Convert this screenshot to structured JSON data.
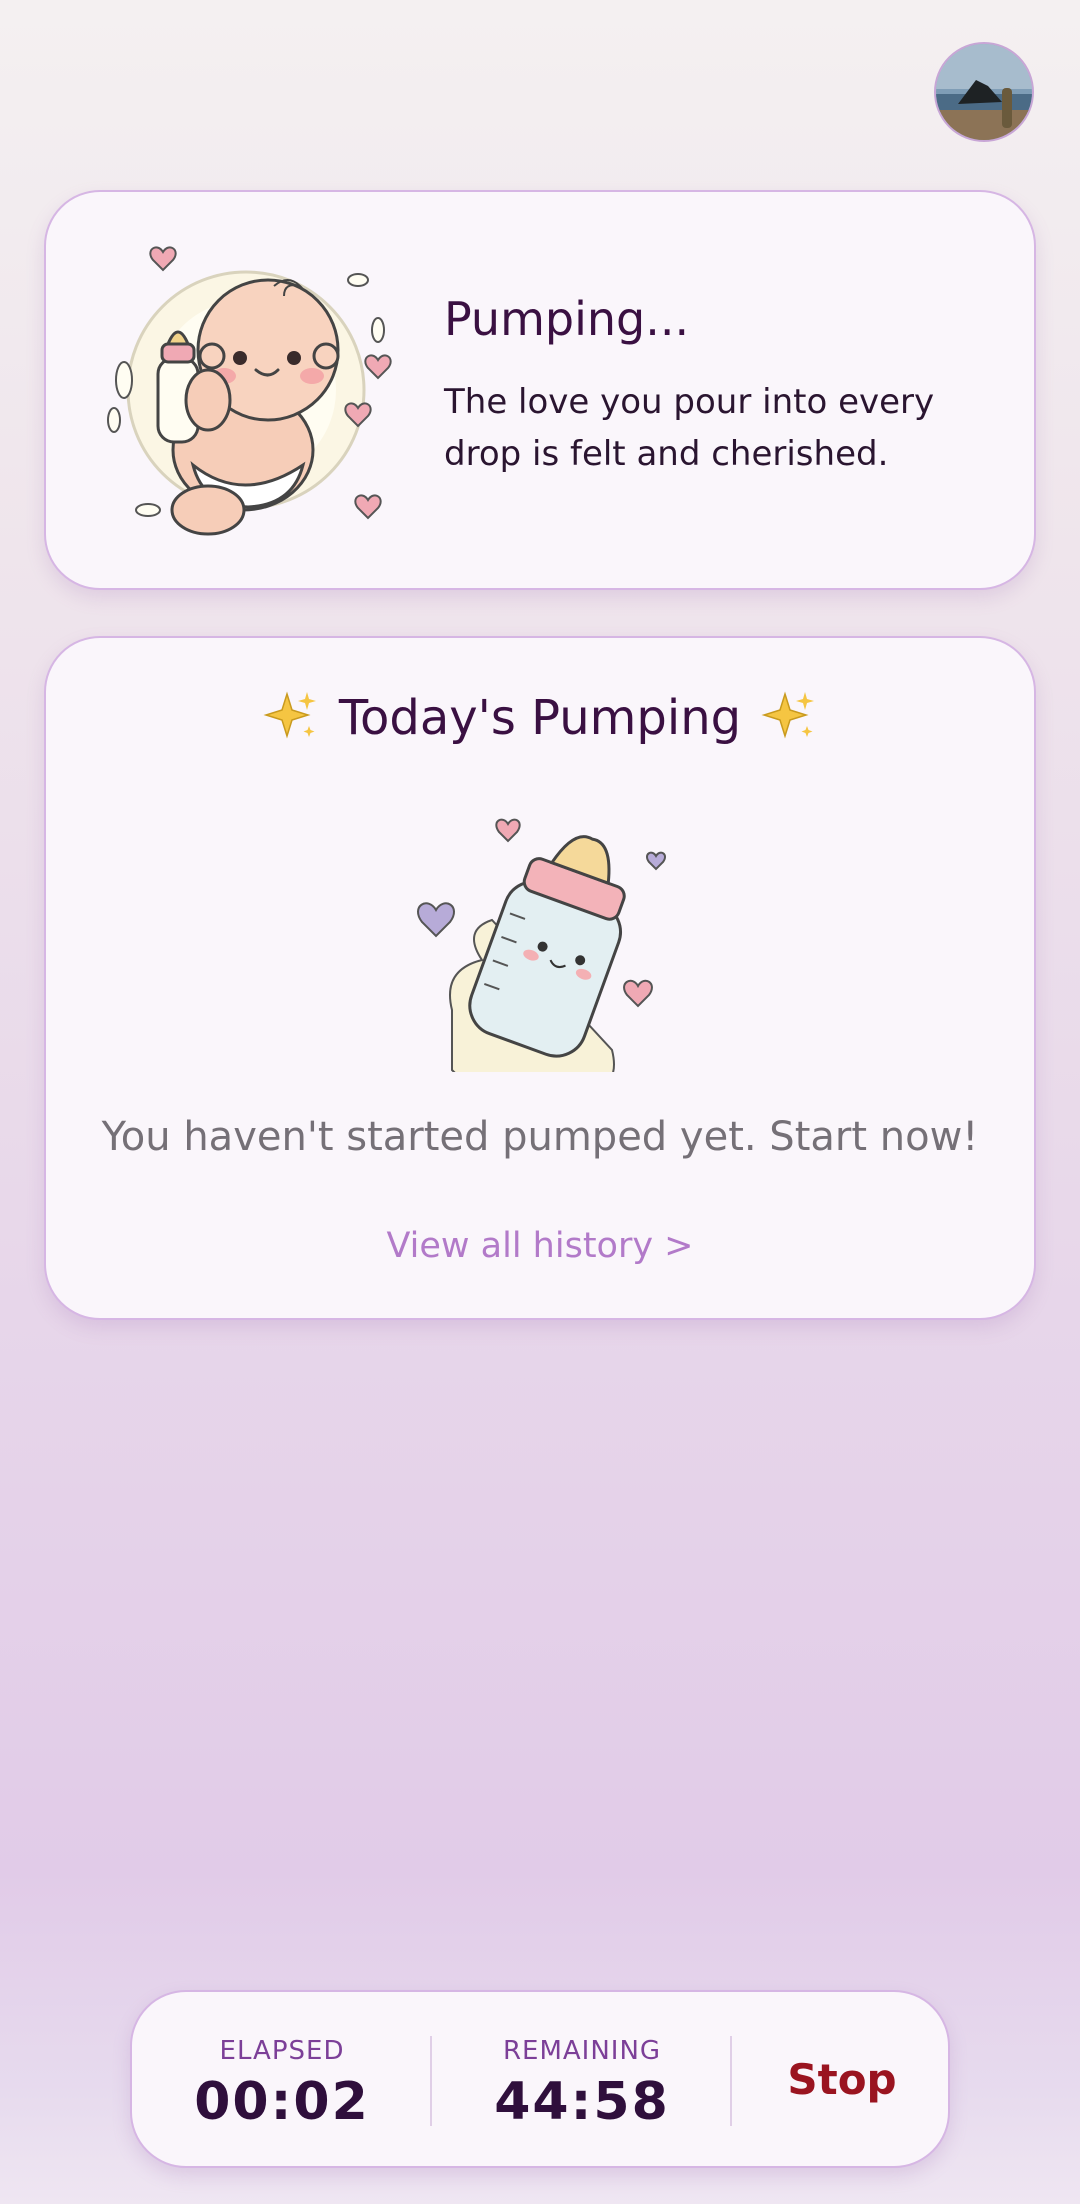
{
  "header": {
    "avatar_label": "Profile"
  },
  "status_card": {
    "title": "Pumping...",
    "message": "The love you pour into every drop is felt and cherished."
  },
  "today_card": {
    "title": "Today's Pumping",
    "sparkle": "✨",
    "empty_message": "You haven't started pumped yet. Start now!",
    "history_link": "View all history >"
  },
  "timer": {
    "elapsed_label": "ELAPSED",
    "elapsed_value": "00:02",
    "remaining_label": "REMAINING",
    "remaining_value": "44:58",
    "stop_label": "Stop"
  },
  "colors": {
    "accent": "#b27ac9",
    "title": "#3a1042",
    "stop": "#9a1420",
    "card_border": "#d6b6e4"
  }
}
